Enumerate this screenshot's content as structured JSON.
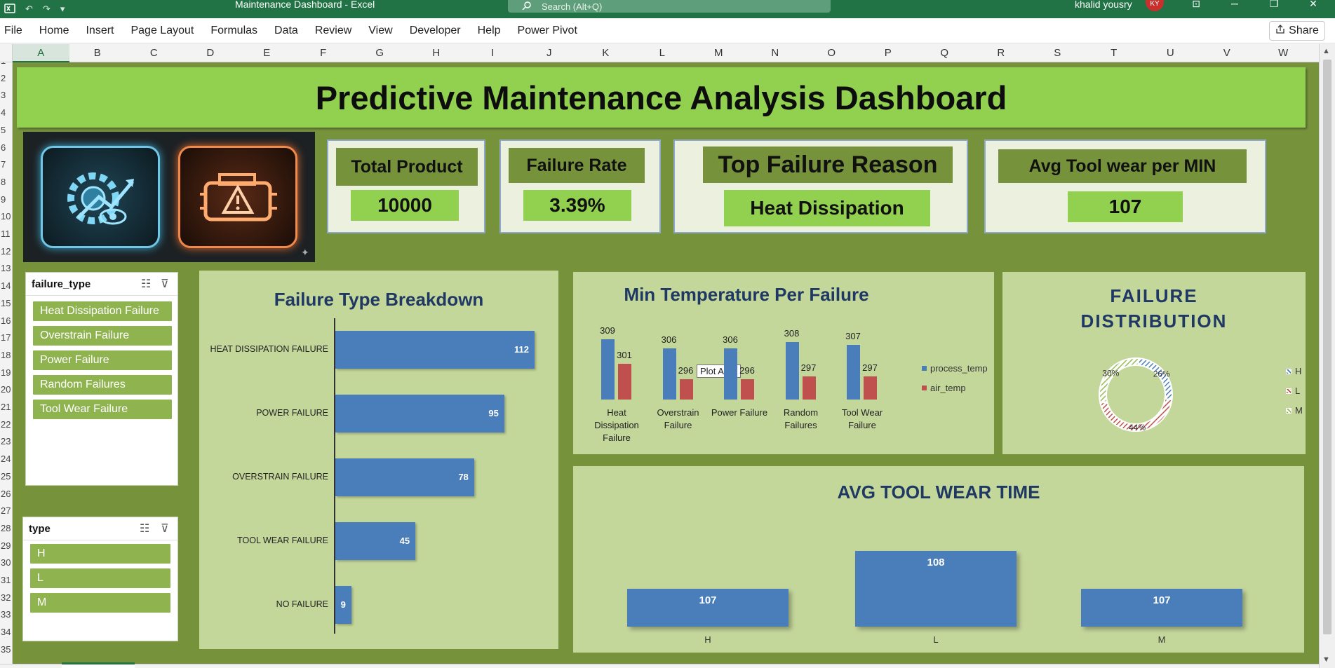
{
  "window": {
    "doc_title": "Maintenance Dashboard  -  Excel",
    "search_placeholder": "Search (Alt+Q)",
    "user_name": "khalid yousry",
    "user_initials": "KY"
  },
  "menu": [
    "File",
    "Home",
    "Insert",
    "Page Layout",
    "Formulas",
    "Data",
    "Review",
    "View",
    "Developer",
    "Help",
    "Power Pivot"
  ],
  "share_label": "Share",
  "columns": [
    "A",
    "B",
    "C",
    "D",
    "E",
    "F",
    "G",
    "H",
    "I",
    "J",
    "K",
    "L",
    "M",
    "N",
    "O",
    "P",
    "Q",
    "R",
    "S",
    "T",
    "U",
    "V",
    "W"
  ],
  "selected_column": "A",
  "rows": [
    "1",
    "2",
    "3",
    "4",
    "5",
    "6",
    "7",
    "8",
    "9",
    "10",
    "11",
    "12",
    "13",
    "14",
    "15",
    "16",
    "17",
    "18",
    "19",
    "20",
    "21",
    "22",
    "23",
    "24",
    "25",
    "26",
    "27",
    "28",
    "29",
    "30",
    "31",
    "32",
    "33",
    "34",
    "35"
  ],
  "dashboard": {
    "title": "Predictive Maintenance Analysis Dashboard",
    "kpis": {
      "total_product": {
        "label": "Total Product",
        "value": "10000"
      },
      "failure_rate": {
        "label": "Failure Rate",
        "value": "3.39%"
      },
      "top_failure": {
        "label": "Top Failure Reason",
        "value": "Heat Dissipation"
      },
      "avg_tool_wear": {
        "label": "Avg Tool wear per MIN",
        "value": "107"
      }
    },
    "slicer_failure_type": {
      "title": "failure_type",
      "items": [
        "Heat Dissipation Failure",
        "Overstrain Failure",
        "Power Failure",
        "Random Failures",
        "Tool Wear Failure"
      ]
    },
    "slicer_type": {
      "title": "type",
      "items": [
        "H",
        "L",
        "M"
      ]
    },
    "tooltip": "Plot Area",
    "colors": {
      "canvas": "#76933c",
      "banner": "#92d050",
      "panel": "#c4d79b",
      "blue": "#4a7ebb",
      "red": "#c0504d",
      "green": "#9bbb59",
      "title_text": "#1f3864"
    }
  },
  "chart_data": [
    {
      "type": "bar",
      "orientation": "horizontal",
      "title": "Failure Type Breakdown",
      "categories": [
        "HEAT DISSIPATION FAILURE",
        "POWER FAILURE",
        "OVERSTRAIN FAILURE",
        "TOOL WEAR FAILURE",
        "NO FAILURE"
      ],
      "values": [
        112,
        95,
        78,
        45,
        9
      ],
      "xlim": [
        0,
        112
      ]
    },
    {
      "type": "bar",
      "title": "Min Temperature Per Failure",
      "categories": [
        "Heat Dissipation Failure",
        "Overstrain Failure",
        "Power Failure",
        "Random Failures",
        "Tool Wear Failure"
      ],
      "series": [
        {
          "name": "process_temp",
          "values": [
            309,
            306,
            306,
            308,
            307
          ],
          "color": "#4a7ebb"
        },
        {
          "name": "air_temp",
          "values": [
            301,
            296,
            296,
            297,
            297
          ],
          "color": "#c0504d"
        }
      ],
      "ylim": [
        290,
        310
      ],
      "legend": "right"
    },
    {
      "type": "pie",
      "donut": true,
      "title": "FAILURE DISTRIBUTION",
      "categories": [
        "H",
        "L",
        "M"
      ],
      "values": [
        26,
        44,
        30
      ],
      "labels": [
        "26%",
        "44%",
        "30%"
      ],
      "colors": [
        "#4a7ebb",
        "#c0504d",
        "#9bbb59"
      ],
      "legend": "right"
    },
    {
      "type": "bar",
      "title": "AVG TOOL WEAR TIME",
      "categories": [
        "H",
        "L",
        "M"
      ],
      "values": [
        107,
        108,
        107
      ],
      "ylim": [
        106,
        108
      ]
    }
  ]
}
